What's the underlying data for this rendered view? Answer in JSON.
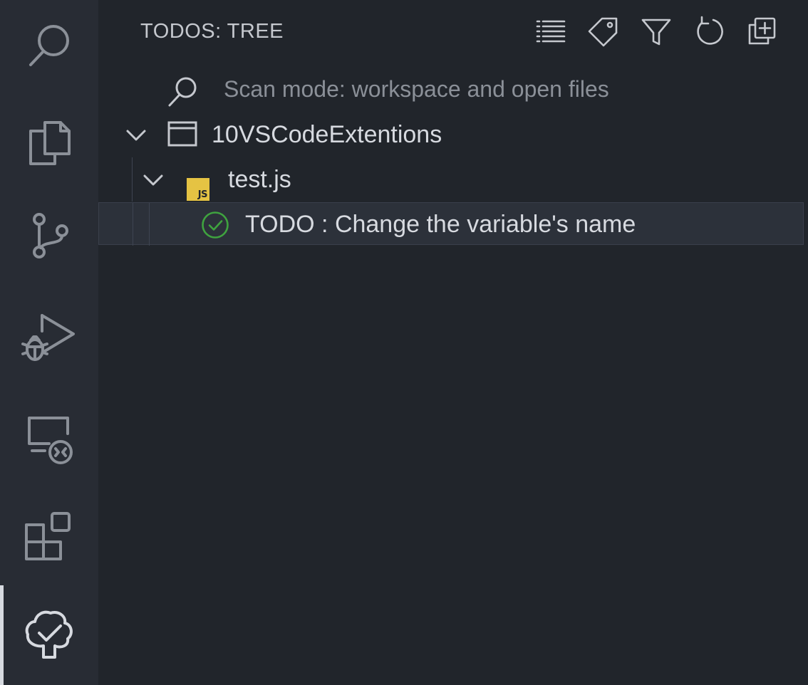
{
  "activity_bar": {
    "items": [
      {
        "icon": "search-icon"
      },
      {
        "icon": "files-icon"
      },
      {
        "icon": "source-control-icon"
      },
      {
        "icon": "run-debug-icon"
      },
      {
        "icon": "remote-explorer-icon"
      },
      {
        "icon": "extensions-icon"
      },
      {
        "icon": "todo-tree-icon",
        "active": true
      }
    ]
  },
  "view": {
    "title": "TODOS: TREE",
    "toolbar": [
      {
        "icon": "view-as-list-icon"
      },
      {
        "icon": "tag-icon"
      },
      {
        "icon": "filter-icon"
      },
      {
        "icon": "refresh-icon"
      },
      {
        "icon": "expand-all-icon"
      }
    ]
  },
  "tree": {
    "scan_mode": "Scan mode: workspace and open files",
    "workspace": "10VSCodeExtentions",
    "file": {
      "name": "test.js",
      "badge": "JS"
    },
    "todo": {
      "text": "TODO : Change the variable's name",
      "status_color": "#3fa33f"
    }
  },
  "colors": {
    "background": "#21252b",
    "activity_bar": "#282c34",
    "selection": "#2c313a",
    "js_badge": "#e5c343"
  }
}
